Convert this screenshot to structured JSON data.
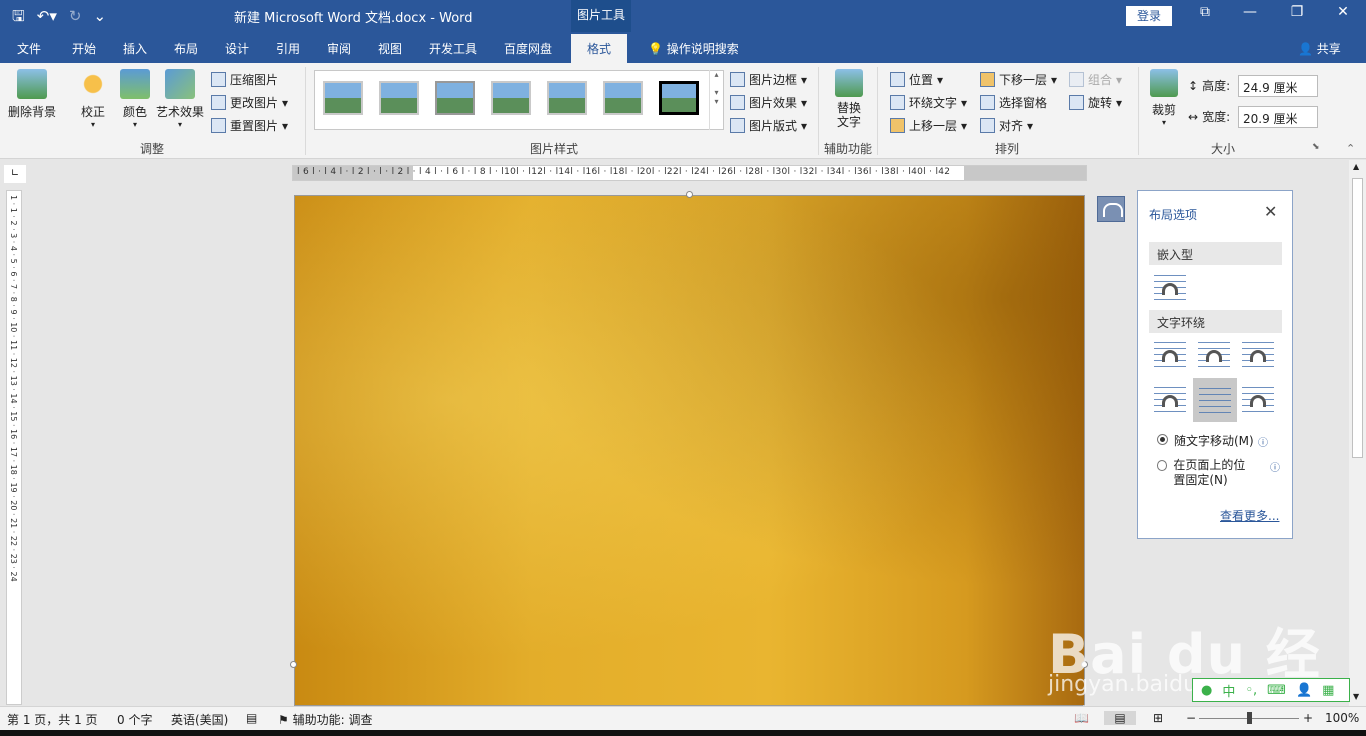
{
  "titlebar": {
    "document_title": "新建 Microsoft Word 文档.docx  -  Word",
    "context_group": "图片工具",
    "login": "登录"
  },
  "menu": {
    "tabs": [
      "文件",
      "开始",
      "插入",
      "布局",
      "设计",
      "引用",
      "审阅",
      "视图",
      "开发工具",
      "百度网盘",
      "格式"
    ],
    "active_tab": "格式",
    "tell_me": "操作说明搜索",
    "share": "共享"
  },
  "ribbon": {
    "adjust": {
      "remove_bg": "删除背景",
      "correct": "校正",
      "color": "颜色",
      "artistic": "艺术效果",
      "compress": "压缩图片",
      "change": "更改图片",
      "reset": "重置图片",
      "label": "调整"
    },
    "styles": {
      "border": "图片边框",
      "effects": "图片效果",
      "layout": "图片版式",
      "label": "图片样式"
    },
    "accessibility": {
      "alt_text": "替换文字",
      "label": "辅助功能"
    },
    "arrange": {
      "position": "位置",
      "wrap_text": "环绕文字",
      "bring_forward": "上移一层",
      "send_backward": "下移一层",
      "selection_pane": "选择窗格",
      "align": "对齐",
      "group": "组合",
      "rotate": "旋转",
      "label": "排列"
    },
    "size": {
      "crop": "裁剪",
      "height_label": "高度:",
      "height_value": "24.9 厘米",
      "width_label": "宽度:",
      "width_value": "20.9 厘米",
      "label": "大小"
    }
  },
  "ruler": {
    "horizontal_numbers": "l 6 l · l 4 l · l 2 l · l · l 2 l · l 4 l · l 6 l · l 8 l · l10l · l12l · l14l · l16l · l18l · l20l · l22l · l24l · l26l · l28l · l30l · l32l · l34l · l36l · l38l · l40l · l42",
    "vertical_numbers": "1 · 1 · 2 · 3 · 4 · 5 · 6 · 7 · 8 · 9 · 10 · 11 · 12 · 13 · 14 · 15 · 16 · 17 · 18 · 19 · 20 · 21 · 22 · 23 · 24"
  },
  "layout_pane": {
    "title": "布局选项",
    "section_inline": "嵌入型",
    "section_wrap": "文字环绕",
    "move_with_text": "随文字移动(M)",
    "fix_position": "在页面上的位置固定(N)",
    "see_more": "查看更多...",
    "selected_option": "move_with_text"
  },
  "statusbar": {
    "page": "第 1 页，共 1 页",
    "words": "0 个字",
    "language": "英语(美国)",
    "accessibility": "辅助功能: 调查",
    "zoom": "100%"
  },
  "watermark": {
    "brand": "Bai du 经验",
    "url": "jingyan.baidu.com",
    "toolbar": "中"
  }
}
